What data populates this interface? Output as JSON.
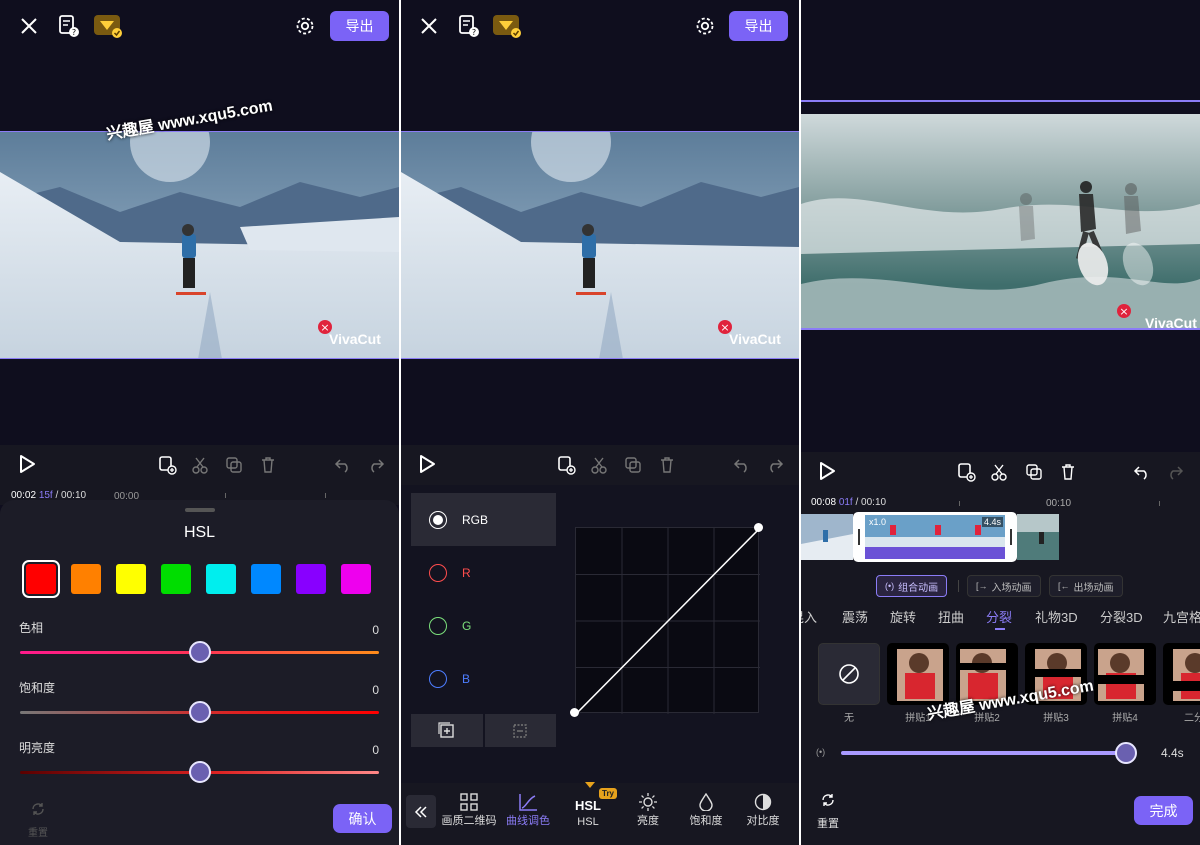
{
  "watermark": "兴趣屋 www.xqu5.com",
  "brand": "VivaCut",
  "colors": {
    "accent": "#7b63f6",
    "bg": "#0f0e1e",
    "panel": "#171721"
  },
  "panel1": {
    "export_label": "导出",
    "time_current": "00:02",
    "time_frame": "15f",
    "time_total": "/ 00:10",
    "ruler_label": "00:00",
    "hsl": {
      "title": "HSL",
      "swatches": [
        "#ff0000",
        "#ff8000",
        "#ffff00",
        "#00dd00",
        "#00eeee",
        "#0088ff",
        "#8800ff",
        "#ee00ee"
      ],
      "hue_label": "色相",
      "hue_value": "0",
      "saturation_label": "饱和度",
      "saturation_value": "0",
      "brightness_label": "明亮度",
      "brightness_value": "0",
      "reset_label": "重置",
      "confirm_label": "确认"
    }
  },
  "panel2": {
    "export_label": "导出",
    "channels": [
      {
        "label": "RGB",
        "color": "#ffffff"
      },
      {
        "label": "R",
        "color": "#ff4d4d"
      },
      {
        "label": "G",
        "color": "#7be07b"
      },
      {
        "label": "B",
        "color": "#4d7dff"
      }
    ],
    "tabs": [
      "画质二维码",
      "曲线调色",
      "HSL",
      "亮度",
      "饱和度",
      "对比度"
    ],
    "hsl_tab_glyph": "HSL",
    "try_badge": "Try"
  },
  "panel3": {
    "time_current": "00:08",
    "time_frame": "01f",
    "time_total": "/ 00:10",
    "ruler_label": "00:10",
    "clip_speed": "x1.0",
    "clip_duration": "4.4s",
    "anim_tabs": [
      "组合动画",
      "入场动画",
      "出场动画"
    ],
    "categories": [
      "晃入",
      "震荡",
      "旋转",
      "扭曲",
      "分裂",
      "礼物3D",
      "分裂3D",
      "九宫格"
    ],
    "effects": [
      "无",
      "拼贴1",
      "拼贴2",
      "拼贴3",
      "拼贴4",
      "二分"
    ],
    "duration_value": "4.4s",
    "reset_label": "重置",
    "done_label": "完成"
  }
}
